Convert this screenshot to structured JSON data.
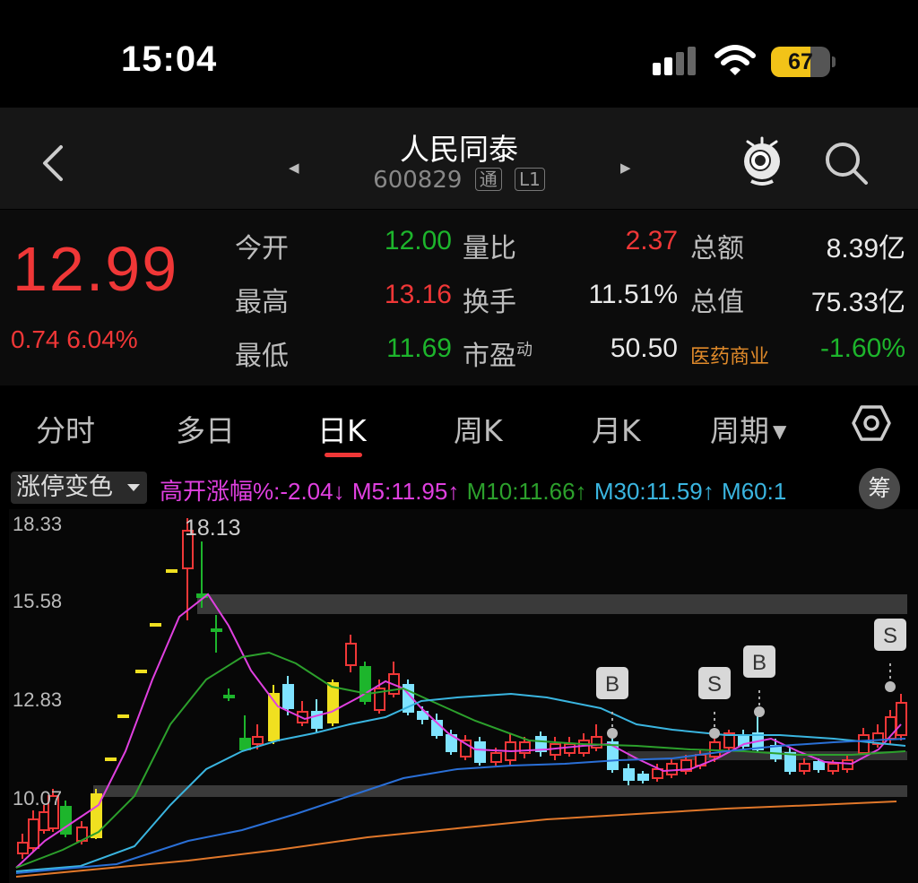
{
  "status": {
    "time": "15:04",
    "battery": "67",
    "battery_level": 0.67
  },
  "header": {
    "stock_name": "人民同泰",
    "stock_code": "600829",
    "tag_tong": "通",
    "tag_level": "L1",
    "prev_arrow": "◀",
    "next_arrow": "▶"
  },
  "quote": {
    "price": "12.99",
    "change": "0.74 6.04%",
    "rows": [
      {
        "l1": "今开",
        "v1": "12.00",
        "c1": "green",
        "l2": "量比",
        "v2": "2.37",
        "c2": "red",
        "l3": "总额",
        "v3": "8.39亿",
        "c3": "white"
      },
      {
        "l1": "最高",
        "v1": "13.16",
        "c1": "red",
        "l2": "换手",
        "v2": "11.51%",
        "c2": "white",
        "l3": "总值",
        "v3": "75.33亿",
        "c3": "white"
      },
      {
        "l1": "最低",
        "v1": "11.69",
        "c1": "green",
        "l2": "市盈动",
        "v2": "50.50",
        "c2": "white",
        "l3": "医药商业",
        "v3": "-1.60%",
        "c3": "green"
      }
    ]
  },
  "tabs": [
    "分时",
    "多日",
    "日K",
    "周K",
    "月K",
    "周期"
  ],
  "indicators": {
    "dropdown": "涨停变色",
    "gap": "高开涨幅%:-2.04↓",
    "m5": "M5:11.95↑",
    "m10": "M10:11.66↑",
    "m30": "M30:11.59↑",
    "m60": "M60:1",
    "chip": "筹"
  },
  "chart_labels": {
    "peak": "18.13",
    "y_ticks": [
      "18.33",
      "15.58",
      "12.83",
      "10.07"
    ]
  },
  "signals": [
    "B",
    "S",
    "B",
    "S"
  ],
  "colors": {
    "up": "#f03737",
    "down": "#1db52c",
    "m5": "#e040e0",
    "m10": "#2ca02c",
    "m30": "#3ab5e0",
    "m60": "#2a6fd6",
    "m120": "#e0772a"
  }
}
